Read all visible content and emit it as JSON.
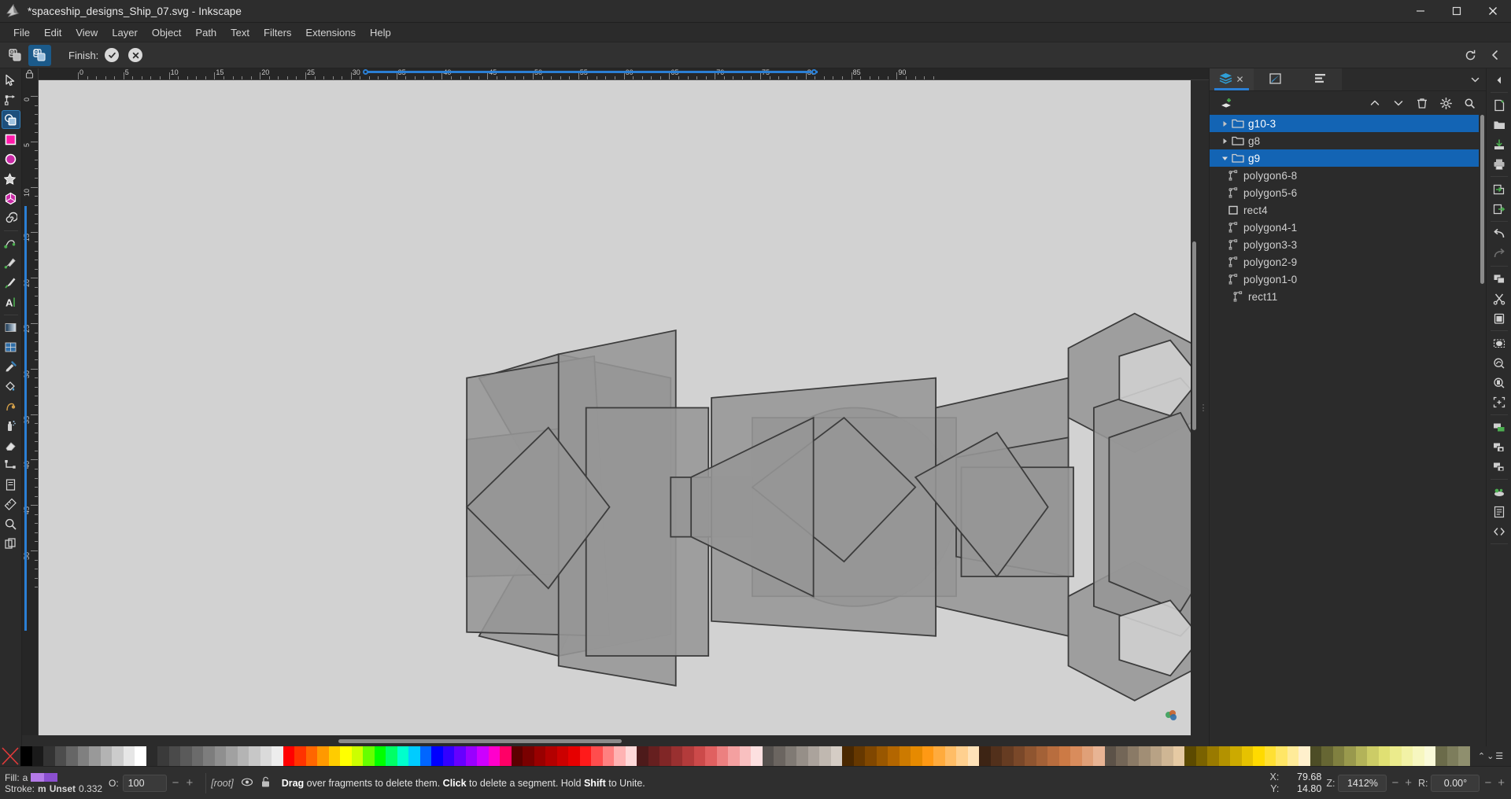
{
  "window": {
    "title": "*spaceship_designs_Ship_07.svg - Inkscape",
    "app_icon": "inkscape-logo-icon",
    "minimize": "–",
    "maximize": "□",
    "close": "✕"
  },
  "menubar": {
    "items": [
      {
        "label": "File"
      },
      {
        "label": "Edit"
      },
      {
        "label": "View"
      },
      {
        "label": "Layer"
      },
      {
        "label": "Object"
      },
      {
        "label": "Path"
      },
      {
        "label": "Text"
      },
      {
        "label": "Filters"
      },
      {
        "label": "Extensions"
      },
      {
        "label": "Help"
      }
    ]
  },
  "tool_controls": {
    "mode_add_label": "builder-add-mode",
    "mode_delete_label": "builder-delete-mode",
    "finish_label": "Finish:",
    "accept_icon": "check-circle-icon",
    "cancel_icon": "x-circle-icon",
    "reset_icon": "reset-icon",
    "collapse_icon": "chevron-left-icon"
  },
  "toolbox": {
    "tools": [
      {
        "name": "selector-tool",
        "icon": "cursor-arrow",
        "selected": false
      },
      {
        "name": "node-tool",
        "icon": "node-editor",
        "selected": false
      },
      {
        "name": "shape-builder-tool",
        "icon": "shape-builder",
        "selected": true
      },
      {
        "name": "rectangle-tool",
        "icon": "square",
        "selected": false
      },
      {
        "name": "ellipse-tool",
        "icon": "circle",
        "selected": false
      },
      {
        "name": "star-tool",
        "icon": "star",
        "selected": false
      },
      {
        "name": "3dbox-tool",
        "icon": "cube",
        "selected": false
      },
      {
        "name": "spiral-tool",
        "icon": "spiral",
        "selected": false
      },
      {
        "name": "pencil-tool",
        "icon": "pencil",
        "selected": false
      },
      {
        "name": "pen-tool",
        "icon": "pen-bezier",
        "selected": false
      },
      {
        "name": "calligraphy-tool",
        "icon": "calligraphy-brush",
        "selected": false
      },
      {
        "name": "text-tool",
        "icon": "letter-a",
        "selected": false
      },
      {
        "name": "gradient-tool",
        "icon": "gradient-square",
        "selected": false
      },
      {
        "name": "mesh-tool",
        "icon": "mesh-grid",
        "selected": false
      },
      {
        "name": "dropper-tool",
        "icon": "eyedropper",
        "selected": false
      },
      {
        "name": "paintbucket-tool",
        "icon": "paint-bucket",
        "selected": false
      },
      {
        "name": "tweak-tool",
        "icon": "tweak-hand",
        "selected": false
      },
      {
        "name": "spray-tool",
        "icon": "spray-can",
        "selected": false
      },
      {
        "name": "eraser-tool",
        "icon": "eraser",
        "selected": false
      },
      {
        "name": "connector-tool",
        "icon": "connector",
        "selected": false
      },
      {
        "name": "lpe-tool",
        "icon": "lpe-page",
        "selected": false
      },
      {
        "name": "measure-tool",
        "icon": "ruler-measure",
        "selected": false
      },
      {
        "name": "zoom-tool",
        "icon": "magnifier",
        "selected": false
      },
      {
        "name": "pages-tool",
        "icon": "pages",
        "selected": false
      }
    ]
  },
  "rulers": {
    "h_labels": [
      "0",
      "5",
      "10",
      "15",
      "20",
      "25",
      "30",
      "35",
      "40",
      "45",
      "50",
      "55",
      "60",
      "65",
      "70",
      "75",
      "80",
      "85",
      "90"
    ],
    "v_labels": [
      "0",
      "5",
      "10",
      "15",
      "20",
      "25",
      "30",
      "35",
      "40",
      "45",
      "50"
    ],
    "unit": "mm"
  },
  "dock": {
    "tabs": [
      {
        "name": "objects-tab",
        "icon": "layers-icon",
        "active": true,
        "close": "✕"
      },
      {
        "name": "fill-stroke-tab",
        "icon": "fill-stroke-icon",
        "active": false
      },
      {
        "name": "align-tab",
        "icon": "align-icon",
        "active": false
      }
    ],
    "collapse_icon": "chevron-down-icon",
    "toolbar": [
      {
        "name": "new-layer-button",
        "icon": "layer-add-icon"
      },
      {
        "name": "raise-button",
        "icon": "chevron-up-icon"
      },
      {
        "name": "lower-button",
        "icon": "chevron-down-icon"
      },
      {
        "name": "delete-button",
        "icon": "trash-icon"
      },
      {
        "name": "settings-button",
        "icon": "gear-icon"
      },
      {
        "name": "search-button",
        "icon": "search-icon"
      }
    ],
    "objects": [
      {
        "label": "g10-3",
        "type": "group",
        "depth": 0,
        "selected": true,
        "expanded": false
      },
      {
        "label": "g8",
        "type": "group",
        "depth": 0,
        "selected": false,
        "expanded": false
      },
      {
        "label": "g9",
        "type": "group",
        "depth": 0,
        "selected": true,
        "expanded": true
      },
      {
        "label": "polygon6-8",
        "type": "path",
        "depth": 1,
        "selected": false
      },
      {
        "label": "polygon5-6",
        "type": "path",
        "depth": 1,
        "selected": false
      },
      {
        "label": "rect4",
        "type": "rect",
        "depth": 1,
        "selected": false
      },
      {
        "label": "polygon4-1",
        "type": "path",
        "depth": 1,
        "selected": false
      },
      {
        "label": "polygon3-3",
        "type": "path",
        "depth": 1,
        "selected": false
      },
      {
        "label": "polygon2-9",
        "type": "path",
        "depth": 1,
        "selected": false
      },
      {
        "label": "polygon1-0",
        "type": "path",
        "depth": 1,
        "selected": false
      },
      {
        "label": "rect11",
        "type": "path",
        "depth": 0,
        "selected": false
      }
    ]
  },
  "right_strip": {
    "collapse_icon": "chevron-left-icon",
    "buttons": [
      {
        "name": "new-document-button",
        "icon": "file-new-icon"
      },
      {
        "name": "open-document-button",
        "icon": "folder-open-icon"
      },
      {
        "name": "save-document-button",
        "icon": "save-icon"
      },
      {
        "name": "print-button",
        "icon": "printer-icon"
      },
      {
        "name": "import-button",
        "icon": "import-icon"
      },
      {
        "name": "export-button",
        "icon": "export-icon"
      },
      {
        "name": "undo-button",
        "icon": "undo-arrow-icon"
      },
      {
        "name": "redo-button",
        "icon": "redo-arrow-icon"
      },
      {
        "name": "copy-button",
        "icon": "copy-icon"
      },
      {
        "name": "cut-button",
        "icon": "scissors-icon"
      },
      {
        "name": "paste-button",
        "icon": "clipboard-icon"
      },
      {
        "name": "zoom-selection-button",
        "icon": "zoom-selection-icon"
      },
      {
        "name": "zoom-drawing-button",
        "icon": "zoom-drawing-icon"
      },
      {
        "name": "zoom-page-button",
        "icon": "zoom-page-icon"
      },
      {
        "name": "zoom-fit-button",
        "icon": "zoom-fit-icon"
      },
      {
        "name": "duplicate-button",
        "icon": "duplicate-icon"
      },
      {
        "name": "group-button",
        "icon": "group-icon"
      },
      {
        "name": "ungroup-button",
        "icon": "ungroup-icon"
      },
      {
        "name": "preferences-button",
        "icon": "preferences-icon"
      },
      {
        "name": "document-properties-button",
        "icon": "doc-properties-icon"
      },
      {
        "name": "xml-editor-button",
        "icon": "xml-icon"
      }
    ]
  },
  "palette": {
    "none_swatch": "none-swatch",
    "colors": [
      "#000000",
      "#1a1a1a",
      "#333333",
      "#4d4d4d",
      "#666666",
      "#808080",
      "#999999",
      "#b3b3b3",
      "#cccccc",
      "#e6e6e6",
      "#ffffff",
      "#2b2b2b",
      "#3a3a3a",
      "#4a4a4a",
      "#5a5a5a",
      "#6b6b6b",
      "#7d7d7d",
      "#8f8f8f",
      "#a1a1a1",
      "#b4b4b4",
      "#c7c7c7",
      "#dadada",
      "#ededed",
      "#ff0000",
      "#ff3300",
      "#ff6600",
      "#ff9900",
      "#ffcc00",
      "#ffff00",
      "#ccff00",
      "#66ff00",
      "#00ff00",
      "#00ff66",
      "#00ffcc",
      "#00ccff",
      "#0066ff",
      "#0000ff",
      "#3300ff",
      "#6600ff",
      "#9900ff",
      "#cc00ff",
      "#ff00cc",
      "#ff0066",
      "#5c0000",
      "#7a0000",
      "#990000",
      "#b30000",
      "#cc0000",
      "#e60000",
      "#ff1a1a",
      "#ff4d4d",
      "#ff8080",
      "#ffb3b3",
      "#ffd9d9",
      "#4d1a1a",
      "#661f1f",
      "#802626",
      "#993030",
      "#b33b3b",
      "#cc4a4a",
      "#e06060",
      "#ec8080",
      "#f4a0a0",
      "#f9c0c0",
      "#fde0e0",
      "#55514e",
      "#6b6560",
      "#807a74",
      "#968f88",
      "#aba39c",
      "#c0b8b0",
      "#d5cdc5",
      "#4a2800",
      "#663800",
      "#804700",
      "#995700",
      "#b36600",
      "#cc7a00",
      "#e68a00",
      "#ff9914",
      "#ffab3d",
      "#ffbd66",
      "#ffd08f",
      "#ffe2b8",
      "#3d2414",
      "#52301b",
      "#663c22",
      "#7a4829",
      "#8f5530",
      "#a36137",
      "#b86d3e",
      "#cc7a45",
      "#d98c5c",
      "#e0a078",
      "#e8b494",
      "#5c5248",
      "#736657",
      "#8a7a66",
      "#a18e75",
      "#b8a285",
      "#cfb694",
      "#e6caa3",
      "#5c4a00",
      "#7a6200",
      "#997a00",
      "#b39200",
      "#ccaa00",
      "#e6c200",
      "#ffda00",
      "#ffe033",
      "#ffe666",
      "#ffeb99",
      "#fff0cc",
      "#4d4d26",
      "#666633",
      "#808040",
      "#99994d",
      "#b3b359",
      "#cccc66",
      "#e0e073",
      "#ebeb8c",
      "#f2f2a6",
      "#f7f7c0",
      "#fafad9",
      "#6b6b4a",
      "#7d7d5c",
      "#8f8f6e"
    ]
  },
  "statusbar": {
    "fill_label": "Fill:",
    "fill_value": "a",
    "stroke_label": "Stroke:",
    "stroke_prefix": "m",
    "stroke_value": "Unset",
    "stroke_width": "0.332",
    "opacity_label": "O:",
    "opacity_value": "100",
    "opacity_minus": "−",
    "opacity_plus": "+",
    "layer_name": "[root]",
    "layer_visibility_icon": "eye-icon",
    "layer_lock_icon": "unlock-icon",
    "message_parts": [
      {
        "text": "Drag",
        "bold": true
      },
      {
        "text": " over fragments to delete them. ",
        "bold": false
      },
      {
        "text": "Click",
        "bold": true
      },
      {
        "text": " to delete a segment. Hold ",
        "bold": false
      },
      {
        "text": "Shift",
        "bold": true
      },
      {
        "text": " to Unite.",
        "bold": false
      }
    ],
    "x_label": "X:",
    "x_value": "79.68",
    "y_label": "Y:",
    "y_value": "14.80",
    "zoom_label": "Z:",
    "zoom_value": "1412%",
    "zoom_minus": "−",
    "zoom_plus": "+",
    "rotation_label": "R:",
    "rotation_value": "0.00°",
    "rot_minus": "−",
    "rot_plus": "+"
  },
  "artwork": {
    "description": "spaceship silhouette composed of overlapping grey polygons",
    "fill": "#969696",
    "stroke": "#3c3c3c"
  }
}
